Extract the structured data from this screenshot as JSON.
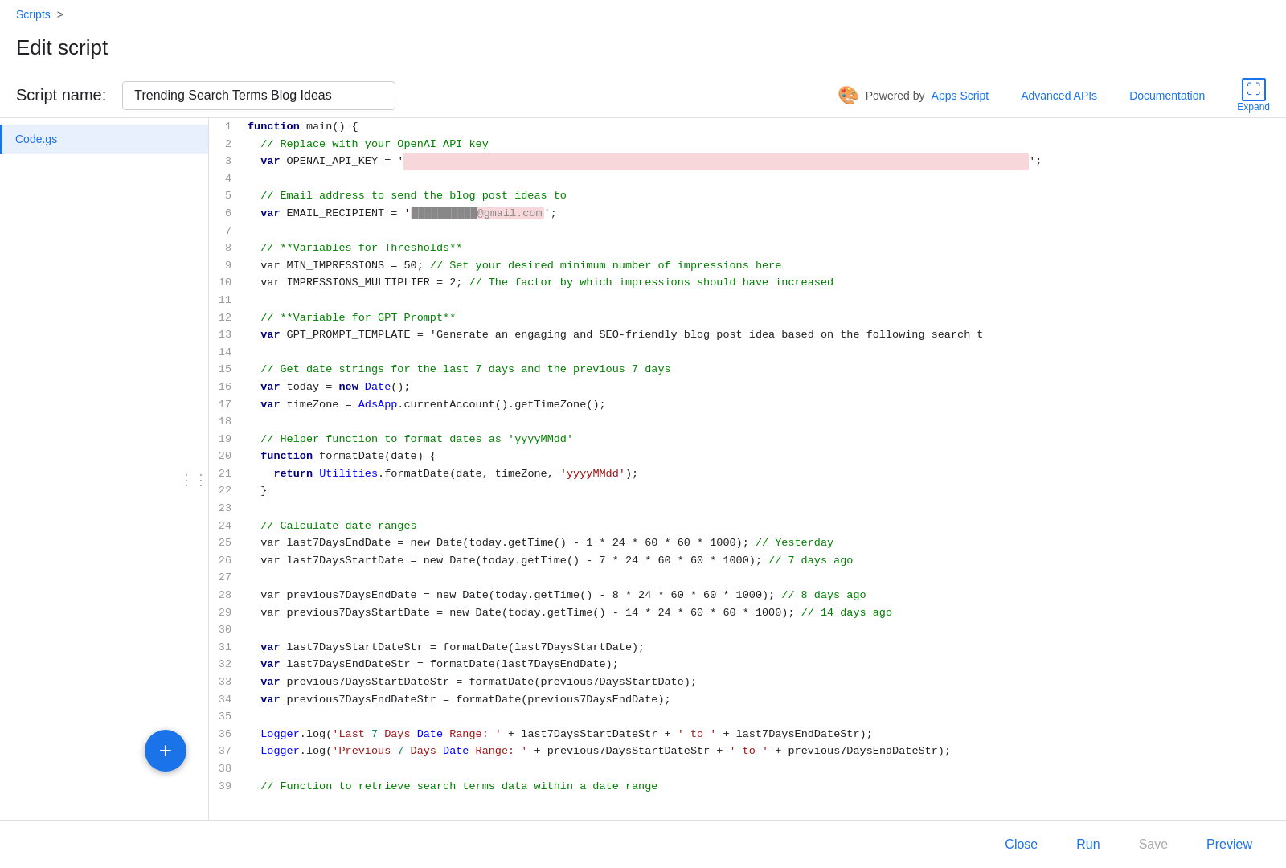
{
  "breadcrumb": {
    "scripts_label": "Scripts",
    "separator": ">"
  },
  "page_title": "Edit script",
  "header": {
    "script_name_label": "Script name:",
    "script_name_value": "Trending Search Terms Blog Ideas",
    "powered_by_text": "Powered by",
    "apps_script_link": "Apps Script",
    "advanced_apis_label": "Advanced APIs",
    "documentation_label": "Documentation",
    "expand_label": "Expand"
  },
  "sidebar": {
    "items": [
      {
        "label": "Code.gs",
        "active": true
      }
    ]
  },
  "code_lines": [
    {
      "n": 1,
      "code": "function main() {"
    },
    {
      "n": 2,
      "code": "  // Replace with your OpenAI API key"
    },
    {
      "n": 3,
      "code": "  var OPENAI_API_KEY = '[REDACTED]';"
    },
    {
      "n": 4,
      "code": ""
    },
    {
      "n": 5,
      "code": "  // Email address to send the blog post ideas to"
    },
    {
      "n": 6,
      "code": "  var EMAIL_RECIPIENT = '[email@gmail.com]';"
    },
    {
      "n": 7,
      "code": ""
    },
    {
      "n": 8,
      "code": "  // **Variables for Thresholds**"
    },
    {
      "n": 9,
      "code": "  var MIN_IMPRESSIONS = 50; // Set your desired minimum number of impressions here"
    },
    {
      "n": 10,
      "code": "  var IMPRESSIONS_MULTIPLIER = 2; // The factor by which impressions should have increased"
    },
    {
      "n": 11,
      "code": ""
    },
    {
      "n": 12,
      "code": "  // **Variable for GPT Prompt**"
    },
    {
      "n": 13,
      "code": "  var GPT_PROMPT_TEMPLATE = 'Generate an engaging and SEO-friendly blog post idea based on the following search t"
    },
    {
      "n": 14,
      "code": ""
    },
    {
      "n": 15,
      "code": "  // Get date strings for the last 7 days and the previous 7 days"
    },
    {
      "n": 16,
      "code": "  var today = new Date();"
    },
    {
      "n": 17,
      "code": "  var timeZone = AdsApp.currentAccount().getTimeZone();"
    },
    {
      "n": 18,
      "code": ""
    },
    {
      "n": 19,
      "code": "  // Helper function to format dates as 'yyyyMMdd'"
    },
    {
      "n": 20,
      "code": "  function formatDate(date) {"
    },
    {
      "n": 21,
      "code": "    return Utilities.formatDate(date, timeZone, 'yyyyMMdd');"
    },
    {
      "n": 22,
      "code": "  }"
    },
    {
      "n": 23,
      "code": ""
    },
    {
      "n": 24,
      "code": "  // Calculate date ranges"
    },
    {
      "n": 25,
      "code": "  var last7DaysEndDate = new Date(today.getTime() - 1 * 24 * 60 * 60 * 1000); // Yesterday"
    },
    {
      "n": 26,
      "code": "  var last7DaysStartDate = new Date(today.getTime() - 7 * 24 * 60 * 60 * 1000); // 7 days ago"
    },
    {
      "n": 27,
      "code": ""
    },
    {
      "n": 28,
      "code": "  var previous7DaysEndDate = new Date(today.getTime() - 8 * 24 * 60 * 60 * 1000); // 8 days ago"
    },
    {
      "n": 29,
      "code": "  var previous7DaysStartDate = new Date(today.getTime() - 14 * 24 * 60 * 60 * 1000); // 14 days ago"
    },
    {
      "n": 30,
      "code": ""
    },
    {
      "n": 31,
      "code": "  var last7DaysStartDateStr = formatDate(last7DaysStartDate);"
    },
    {
      "n": 32,
      "code": "  var last7DaysEndDateStr = formatDate(last7DaysEndDate);"
    },
    {
      "n": 33,
      "code": "  var previous7DaysStartDateStr = formatDate(previous7DaysStartDate);"
    },
    {
      "n": 34,
      "code": "  var previous7DaysEndDateStr = formatDate(previous7DaysEndDate);"
    },
    {
      "n": 35,
      "code": ""
    },
    {
      "n": 36,
      "code": "  Logger.log('Last 7 Days Date Range: ' + last7DaysStartDateStr + ' to ' + last7DaysEndDateStr);"
    },
    {
      "n": 37,
      "code": "  Logger.log('Previous 7 Days Date Range: ' + previous7DaysStartDateStr + ' to ' + previous7DaysEndDateStr);"
    },
    {
      "n": 38,
      "code": ""
    },
    {
      "n": 39,
      "code": "  // Function to retrieve search terms data within a date range"
    }
  ],
  "fab": {
    "label": "+"
  },
  "bottom_bar": {
    "close_label": "Close",
    "run_label": "Run",
    "save_label": "Save",
    "preview_label": "Preview"
  }
}
